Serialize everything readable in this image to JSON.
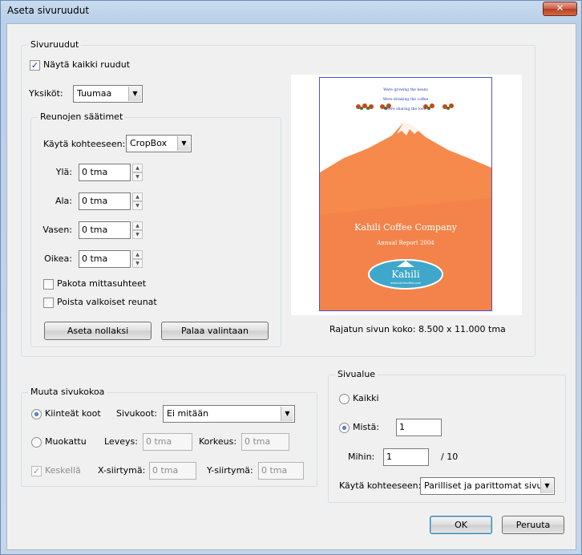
{
  "window": {
    "title": "Aseta sivuruudut",
    "close_label": "✕"
  },
  "margins_group": {
    "label": "Sivuruudut",
    "show_all_boxes_label": "Näytä kaikki ruudut",
    "show_all_boxes_checked": true,
    "units_label": "Yksiköt:",
    "units_value": "Tuumaa"
  },
  "margin_controls": {
    "label": "Reunojen säätimet",
    "apply_to_label": "Käytä kohteeseen:",
    "apply_to_value": "CropBox",
    "fields": [
      {
        "label": "Ylä:",
        "value": "0 tma"
      },
      {
        "label": "Ala:",
        "value": "0 tma"
      },
      {
        "label": "Vasen:",
        "value": "0 tma"
      },
      {
        "label": "Oikea:",
        "value": "0 tma"
      }
    ],
    "constrain_label": "Pakota mittasuhteet",
    "remove_white_label": "Poista valkoiset reunat",
    "set_zero_label": "Aseta nollaksi",
    "revert_label": "Palaa valintaan"
  },
  "preview": {
    "tagline": [
      "Were growing the beans",
      "Were drinking the coffee",
      "Were sharing the love"
    ],
    "company": "Kahili Coffee Company",
    "report": "Annual Report 2004",
    "logo_text": "Kahili",
    "logo_sub": "www.kahilicoffee.com",
    "cropped_size_text": "Rajatun sivun koko: 8.500 x 11.000 tma",
    "colors": {
      "orange": "#f58a4c",
      "sky": "#ffffff",
      "tagline": "#2a3da0",
      "logo": "#3fa7c9"
    }
  },
  "page_size": {
    "label": "Muuta sivukokoa",
    "fixed_label": "Kiinteät koot",
    "page_sizes_label": "Sivukoot:",
    "page_sizes_value": "Ei mitään",
    "custom_label": "Muokattu",
    "width_label": "Leveys:",
    "width_value": "0 tma",
    "height_label": "Korkeus:",
    "height_value": "0 tma",
    "center_label": "Keskellä",
    "xoffset_label": "X-siirtymä:",
    "xoffset_value": "0 tma",
    "yoffset_label": "Y-siirtymä:",
    "yoffset_value": "0 tma"
  },
  "page_range": {
    "label": "Sivualue",
    "all_label": "Kaikki",
    "from_label": "Mistä:",
    "from_value": "1",
    "to_label": "Mihin:",
    "to_value": "1",
    "total_text": "/ 10",
    "apply_label": "Käytä kohteeseen:",
    "apply_value": "Parilliset ja parittomat sivut"
  },
  "footer": {
    "ok_label": "OK",
    "cancel_label": "Peruuta"
  }
}
